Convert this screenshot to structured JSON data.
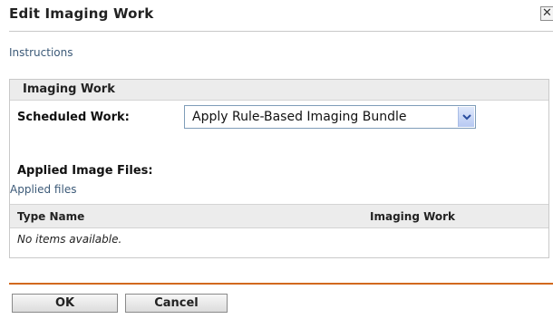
{
  "dialog": {
    "title": "Edit Imaging Work",
    "close_glyph": "✕",
    "instructions_link": "Instructions"
  },
  "section": {
    "header": "Imaging Work",
    "scheduled_work_label": "Scheduled Work:",
    "scheduled_work_value": "Apply Rule-Based Imaging Bundle",
    "applied_files_label": "Applied Image Files:",
    "applied_files_sub": "Applied files"
  },
  "table": {
    "columns": [
      "Type Name",
      "Imaging Work"
    ],
    "empty_message": "No items available."
  },
  "footer": {
    "ok_label": "OK",
    "cancel_label": "Cancel"
  },
  "colors": {
    "accent_rule": "#d2691e",
    "link": "#3c5a78"
  }
}
